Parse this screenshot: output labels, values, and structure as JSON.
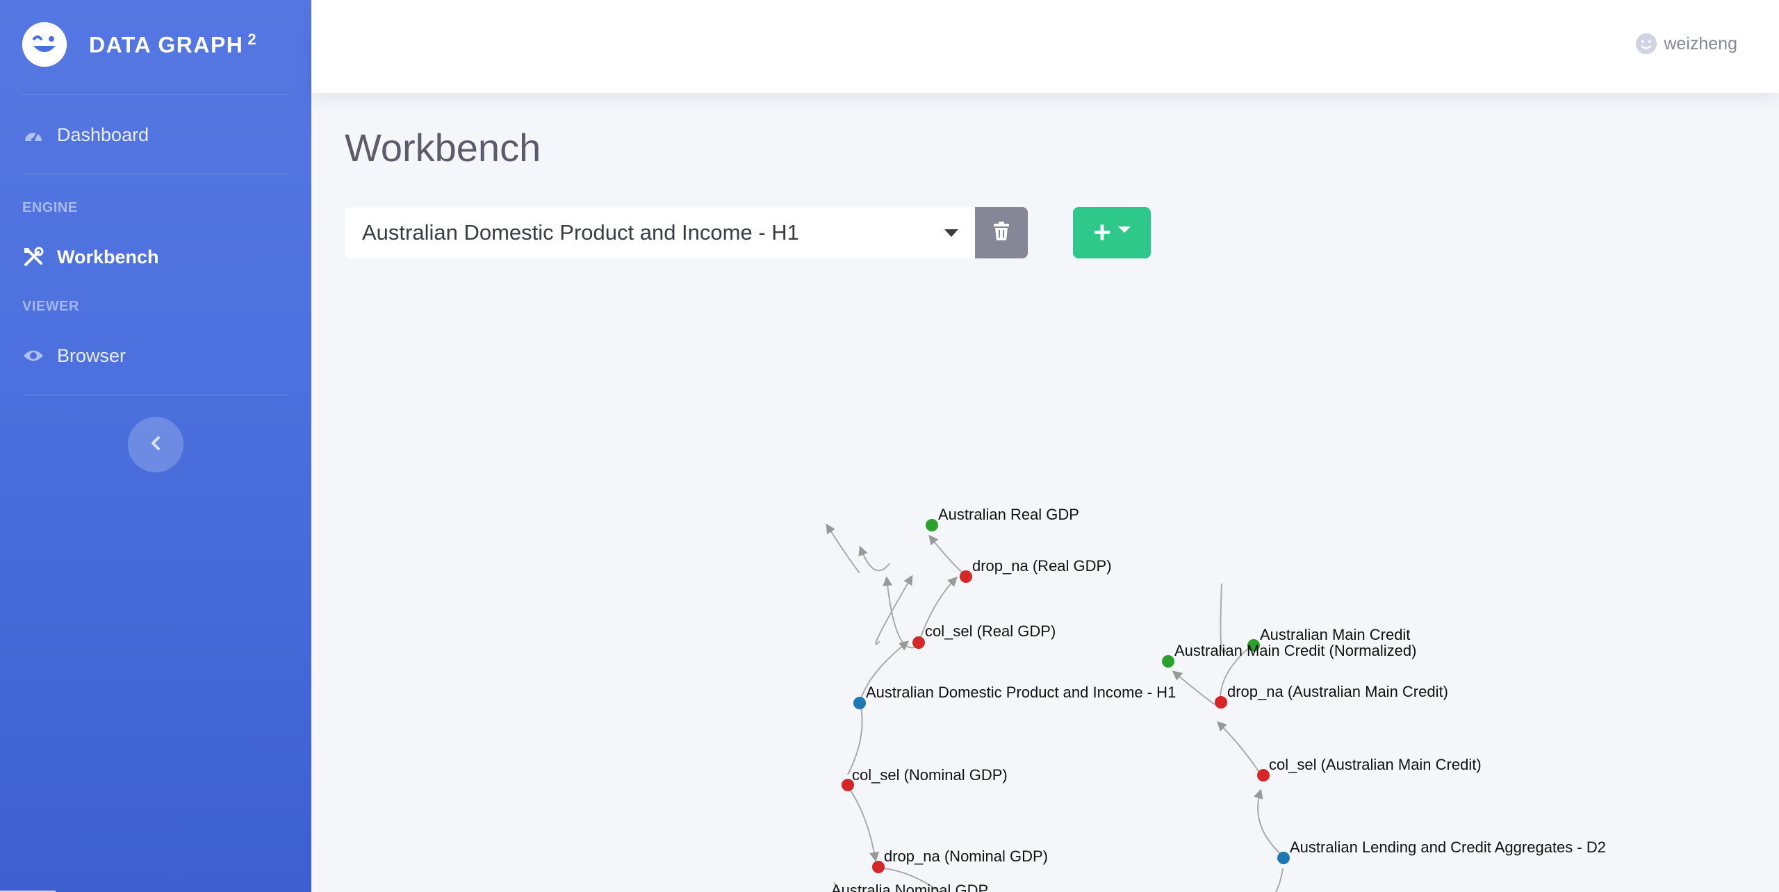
{
  "brand": {
    "name": "DATA GRAPH",
    "superscript": "2"
  },
  "sidebar": {
    "items": [
      {
        "label": "Dashboard",
        "icon": "tachometer-icon"
      },
      {
        "label": "Workbench",
        "icon": "tools-icon",
        "active": true
      },
      {
        "label": "Browser",
        "icon": "eye-icon"
      }
    ],
    "headings": {
      "engine": "ENGINE",
      "viewer": "VIEWER"
    },
    "collapse_icon": "chevron-left-icon"
  },
  "topbar": {
    "username": "weizheng"
  },
  "page": {
    "title": "Workbench"
  },
  "toolbar": {
    "selected_dataset": "Australian Domestic Product and Income - H1",
    "delete_icon": "trash-icon",
    "add_icon": "plus-icon"
  },
  "colors": {
    "sidebar": "#4a6fdc",
    "add_button": "#2dc88a",
    "delete_button": "#858796",
    "node_source": "#1f77b4",
    "node_transform": "#d62728",
    "node_output": "#2ca02c",
    "edge": "#aaaaaa"
  },
  "graph": {
    "nodes": [
      {
        "id": "n_real_gdp",
        "label": "Australian Real GDP",
        "kind": "output"
      },
      {
        "id": "n_dropna_real",
        "label": "drop_na (Real GDP)",
        "kind": "transform"
      },
      {
        "id": "n_colsel_real",
        "label": "col_sel (Real GDP)",
        "kind": "transform"
      },
      {
        "id": "n_h1",
        "label": "Australian Domestic Product and Income - H1",
        "kind": "source"
      },
      {
        "id": "n_colsel_nominal",
        "label": "col_sel (Nominal GDP)",
        "kind": "transform"
      },
      {
        "id": "n_dropna_nominal",
        "label": "drop_na (Nominal GDP)",
        "kind": "transform"
      },
      {
        "id": "n_nominal_gdp",
        "label": "Australia Nominal GDP",
        "kind": "output"
      },
      {
        "id": "n_main_credit",
        "label": "Australian Main Credit",
        "kind": "output"
      },
      {
        "id": "n_main_credit_norm",
        "label": "Australian Main Credit (Normalized)",
        "kind": "output"
      },
      {
        "id": "n_dropna_credit",
        "label": "drop_na (Australian Main Credit)",
        "kind": "transform"
      },
      {
        "id": "n_colsel_credit",
        "label": "col_sel (Australian Main Credit)",
        "kind": "transform"
      },
      {
        "id": "n_d2",
        "label": "Australian Lending and Credit Aggregates - D2",
        "kind": "source"
      }
    ]
  }
}
